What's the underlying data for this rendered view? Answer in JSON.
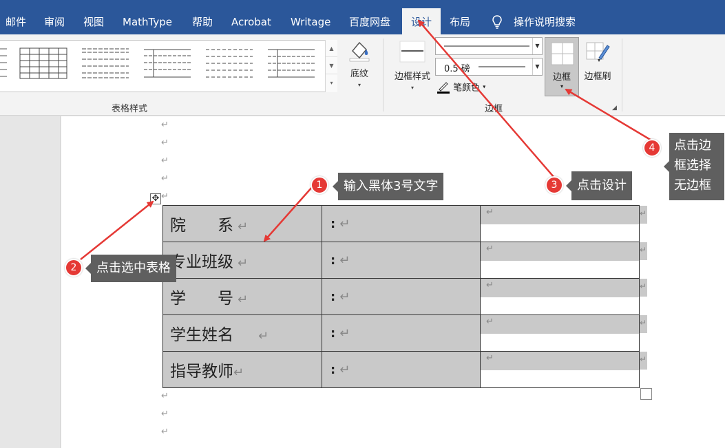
{
  "tabs": [
    "邮件",
    "审阅",
    "视图",
    "MathType",
    "帮助",
    "Acrobat",
    "Writage",
    "百度网盘",
    "设计",
    "布局"
  ],
  "active_tab": "设计",
  "search_label": "操作说明搜索",
  "ribbon": {
    "shading_label": "底纹",
    "table_styles_group": "表格样式",
    "border_styles_label": "边框样式",
    "pen_weight_value": "0.5 磅",
    "pen_color_label": "笔颜色",
    "borders_label": "边框",
    "border_painter_label": "边框刷",
    "borders_group": "边框"
  },
  "table": {
    "rows": [
      {
        "label": "院　　系"
      },
      {
        "label": "专业班级"
      },
      {
        "label": "学　　号"
      },
      {
        "label": "学生姓名"
      },
      {
        "label": "指导教师"
      }
    ],
    "colon": ":"
  },
  "para_mark": "↵",
  "callouts": [
    {
      "num": "1",
      "text": "输入黑体3号文字"
    },
    {
      "num": "2",
      "text": "点击选中表格"
    },
    {
      "num": "3",
      "text": "点击设计"
    },
    {
      "num": "4",
      "text": "点击边框选择无边框"
    }
  ],
  "colors": {
    "tab_bar": "#2b579a",
    "shading": "#c9c9c9",
    "callout_red": "#e53935"
  }
}
